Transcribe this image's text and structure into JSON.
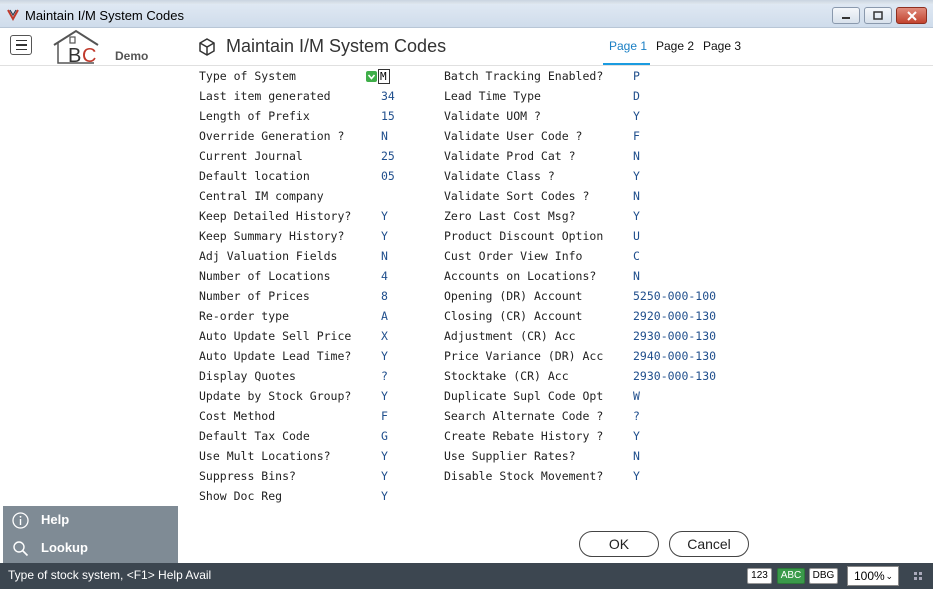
{
  "window": {
    "title": "Maintain I/M System Codes"
  },
  "header": {
    "logo_demo": "Demo",
    "page_title": "Maintain I/M System Codes",
    "tabs": [
      "Page 1",
      "Page 2",
      "Page 3"
    ],
    "active_tab": "Page 1"
  },
  "form": {
    "left": [
      {
        "label": "Type of System",
        "value": "M"
      },
      {
        "label": "Last item generated",
        "value": "34"
      },
      {
        "label": "Length of Prefix",
        "value": "15"
      },
      {
        "label": "Override Generation ?",
        "value": "N"
      },
      {
        "label": "Current Journal",
        "value": "25"
      },
      {
        "label": "Default location",
        "value": "05"
      },
      {
        "label": "Central IM company",
        "value": ""
      },
      {
        "label": "Keep Detailed History?",
        "value": "Y"
      },
      {
        "label": "Keep Summary History?",
        "value": "Y"
      },
      {
        "label": "Adj Valuation Fields",
        "value": "N"
      },
      {
        "label": "Number of Locations",
        "value": "4"
      },
      {
        "label": "Number of Prices",
        "value": "8"
      },
      {
        "label": "Re-order type",
        "value": "A"
      },
      {
        "label": "Auto Update Sell Price",
        "value": "X"
      },
      {
        "label": "Auto Update Lead Time?",
        "value": "Y"
      },
      {
        "label": "Display Quotes",
        "value": "?"
      },
      {
        "label": "Update by Stock Group?",
        "value": "Y"
      },
      {
        "label": "Cost Method",
        "value": "F"
      },
      {
        "label": "Default Tax Code",
        "value": "G"
      },
      {
        "label": "Use Mult Locations?",
        "value": "Y"
      },
      {
        "label": "Suppress Bins?",
        "value": "Y"
      },
      {
        "label": "Show Doc Reg",
        "value": "Y"
      }
    ],
    "right": [
      {
        "label": "Batch Tracking Enabled?",
        "value": "P"
      },
      {
        "label": "Lead Time Type",
        "value": "D"
      },
      {
        "label": "Validate UOM ?",
        "value": "Y"
      },
      {
        "label": "Validate User Code ?",
        "value": "F"
      },
      {
        "label": "Validate Prod Cat ?",
        "value": "N"
      },
      {
        "label": "Validate Class ?",
        "value": "Y"
      },
      {
        "label": "Validate Sort Codes ?",
        "value": "N"
      },
      {
        "label": "Zero Last Cost Msg?",
        "value": "Y"
      },
      {
        "label": "Product Discount Option",
        "value": "U"
      },
      {
        "label": "Cust Order View Info",
        "value": "C"
      },
      {
        "label": "Accounts on Locations?",
        "value": "N"
      },
      {
        "label": "Opening (DR) Account",
        "value": "5250-000-100"
      },
      {
        "label": "Closing (CR) Account",
        "value": "2920-000-130"
      },
      {
        "label": "Adjustment (CR) Acc",
        "value": "2930-000-130"
      },
      {
        "label": "Price Variance (DR) Acc",
        "value": "2940-000-130"
      },
      {
        "label": "Stocktake (CR) Acc",
        "value": "2930-000-130"
      },
      {
        "label": "Duplicate Supl Code Opt",
        "value": "W"
      },
      {
        "label": "Search Alternate Code ?",
        "value": "?"
      },
      {
        "label": "Create Rebate History ?",
        "value": "Y"
      },
      {
        "label": "Use Supplier Rates?",
        "value": "N"
      },
      {
        "label": "Disable Stock Movement?",
        "value": "Y"
      }
    ]
  },
  "side_panel": {
    "help_label": "Help",
    "lookup_label": "Lookup"
  },
  "buttons": {
    "ok_label": "OK",
    "cancel_label": "Cancel"
  },
  "statusbar": {
    "message": "Type of stock system, <F1> Help Avail",
    "badge_123": "123",
    "badge_abc": "ABC",
    "badge_dbg": "DBG",
    "zoom": "100%"
  },
  "colors": {
    "accent": "#1a9be0",
    "statusbar_bg": "#3c4650",
    "side_panel_bg": "#7f8b95",
    "abc_badge": "#3a9a4a"
  }
}
